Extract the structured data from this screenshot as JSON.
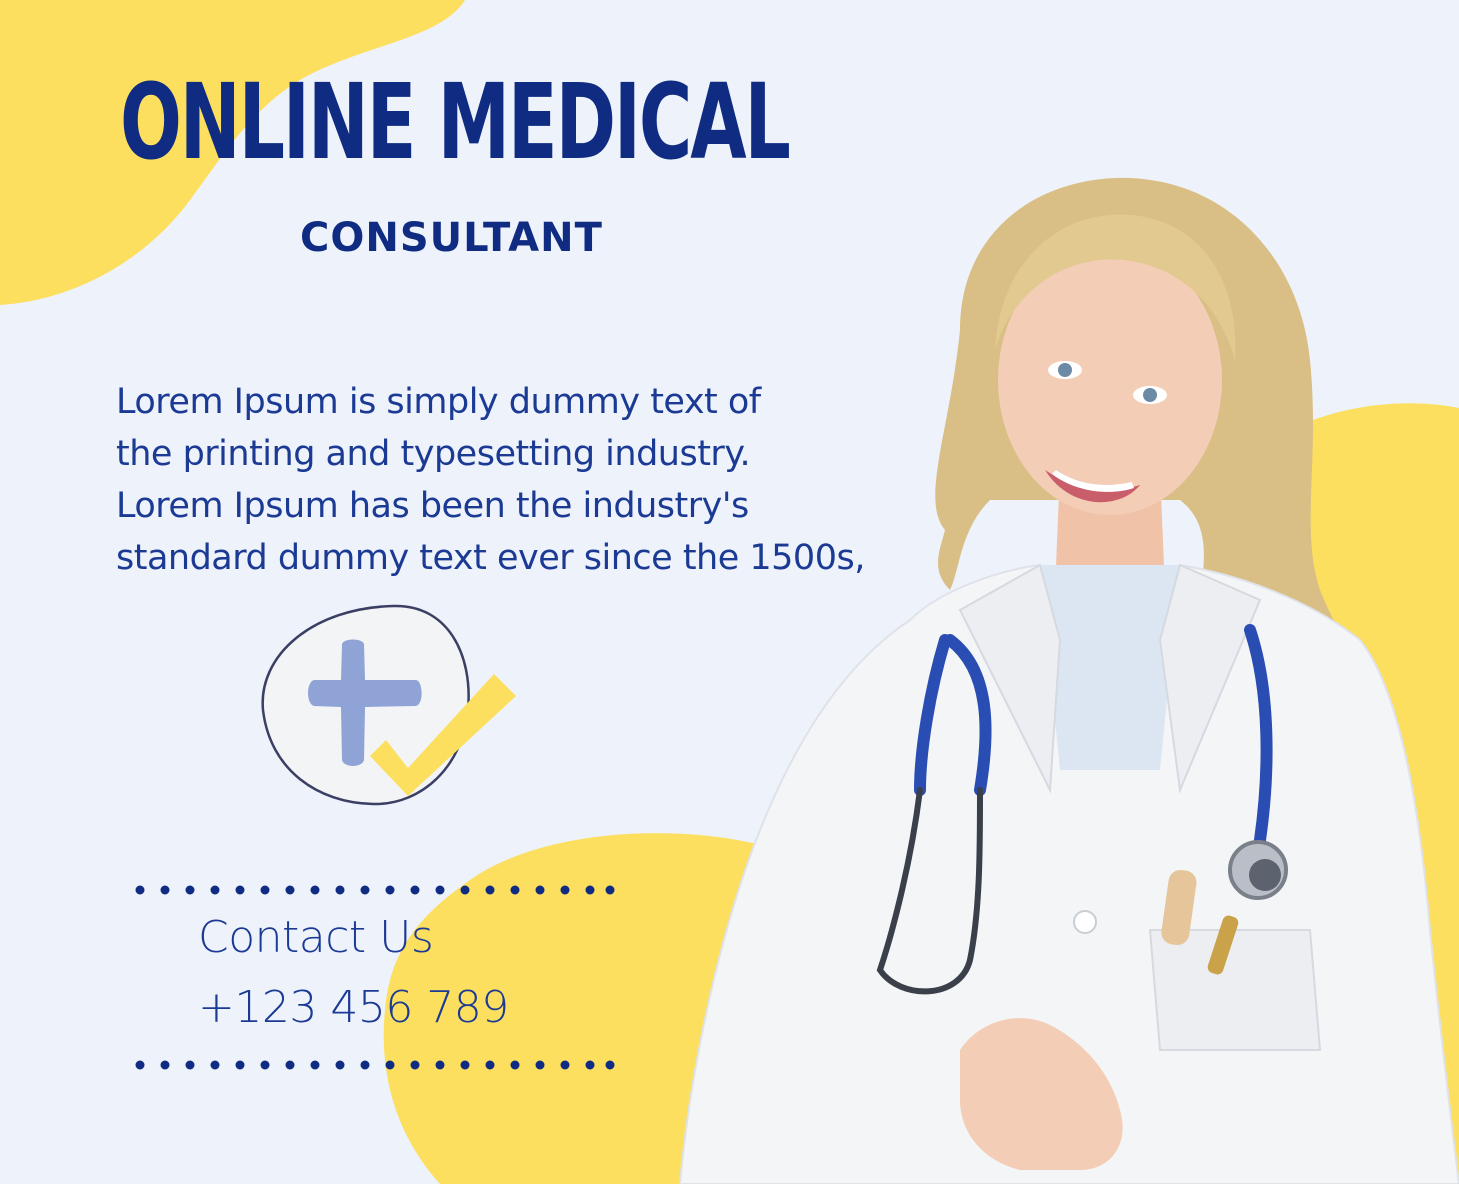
{
  "title": "ONLINE MEDICAL",
  "subtitle": "CONSULTANT",
  "body_lines": [
    "Lorem Ipsum is simply dummy text of",
    "the printing and typesetting industry.",
    "Lorem Ipsum has been the industry's",
    "standard dummy text ever since the 1500s,"
  ],
  "contact": {
    "label": "Contact Us",
    "phone": "+123 456 789"
  },
  "colors": {
    "background": "#eef2fb",
    "navy": "#0f2c82",
    "yellow": "#fcdf5f",
    "cross": "#8fa3d6"
  },
  "icons": {
    "badge": "medical-cross-check-icon"
  }
}
